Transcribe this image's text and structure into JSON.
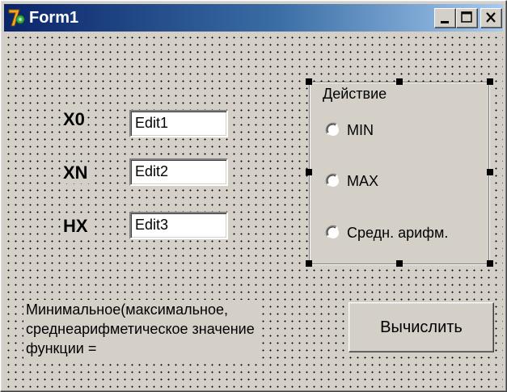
{
  "window": {
    "title": "Form1",
    "icon": "delphi-app-icon",
    "controls": {
      "minimize": "minimize-icon",
      "maximize": "maximize-icon",
      "close": "close-icon"
    }
  },
  "form": {
    "labels": {
      "x0": "X0",
      "xn": "XN",
      "hx": "HX"
    },
    "edits": {
      "edit1": "Edit1",
      "edit2": "Edit2",
      "edit3": "Edit3"
    },
    "group": {
      "caption": "Действие",
      "options": [
        "MIN",
        "MAX",
        "Средн. арифм."
      ]
    },
    "result": {
      "line1": "Минимальное(максимальное,",
      "line2": "среднеарифметическое значение",
      "line3": "функции ="
    },
    "button_label": "Вычислить"
  },
  "colors": {
    "face": "#d4d0c8",
    "title_start": "#0a246a",
    "title_end": "#a6caf0"
  }
}
